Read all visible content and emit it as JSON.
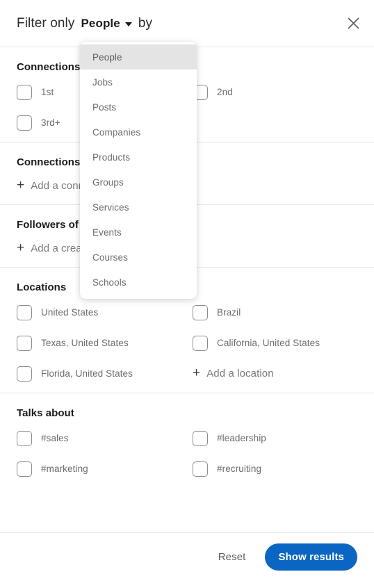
{
  "header": {
    "lead_text": "Filter only",
    "entity_selected": "People",
    "trail_text": "by",
    "close_label": "Close"
  },
  "dropdown": {
    "open": true,
    "selected": "People",
    "items": [
      {
        "label": "People"
      },
      {
        "label": "Jobs"
      },
      {
        "label": "Posts"
      },
      {
        "label": "Companies"
      },
      {
        "label": "Products"
      },
      {
        "label": "Groups"
      },
      {
        "label": "Services"
      },
      {
        "label": "Events"
      },
      {
        "label": "Courses"
      },
      {
        "label": "Schools"
      }
    ]
  },
  "sections": {
    "connections": {
      "title": "Connections",
      "options": [
        {
          "label": "1st",
          "checked": false
        },
        {
          "label": "2nd",
          "checked": false
        },
        {
          "label": "3rd+",
          "checked": false
        }
      ]
    },
    "connections_of": {
      "title": "Connections of",
      "add_label": "Add a connection",
      "plus": "+"
    },
    "followers_of": {
      "title": "Followers of",
      "add_label": "Add a creator",
      "plus": "+"
    },
    "locations": {
      "title": "Locations",
      "options": [
        {
          "label": "United States",
          "checked": false
        },
        {
          "label": "Brazil",
          "checked": false
        },
        {
          "label": "Texas, United States",
          "checked": false
        },
        {
          "label": "California, United States",
          "checked": false
        },
        {
          "label": "Florida, United States",
          "checked": false
        }
      ],
      "add_label": "Add a location",
      "plus": "+"
    },
    "talks_about": {
      "title": "Talks about",
      "options": [
        {
          "label": "#sales",
          "checked": false
        },
        {
          "label": "#leadership",
          "checked": false
        },
        {
          "label": "#marketing",
          "checked": false
        },
        {
          "label": "#recruiting",
          "checked": false
        }
      ]
    }
  },
  "footer": {
    "reset_label": "Reset",
    "show_results_label": "Show results"
  },
  "colors": {
    "accent": "#0a66c2",
    "divider": "#e6e6e6",
    "label_text": "#6b6b6b",
    "title_text": "#1a1a1a",
    "dropdown_selected_bg": "#e4e4e4"
  }
}
